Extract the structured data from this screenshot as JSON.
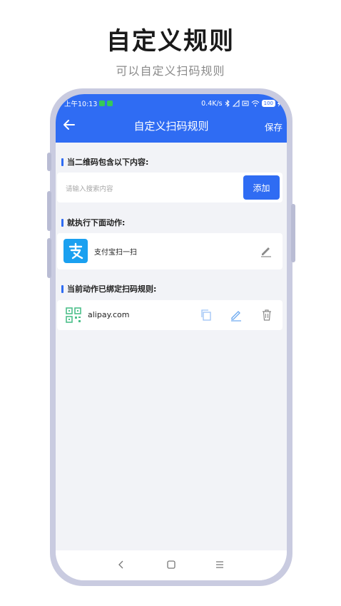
{
  "promo": {
    "title": "自定义规则",
    "subtitle": "可以自定义扫码规则"
  },
  "status_bar": {
    "time": "上午10:13",
    "speed": "0.4K/s",
    "battery": "100"
  },
  "header": {
    "title": "自定义扫码规则",
    "save_label": "保存"
  },
  "section_match": {
    "label": "当二维码包含以下内容:",
    "search_placeholder": "请输入搜索内容",
    "add_label": "添加"
  },
  "section_action": {
    "label": "就执行下面动作:",
    "action_name": "支付宝扫一扫"
  },
  "section_rules": {
    "label": "当前动作已绑定扫码规则:",
    "rules": [
      {
        "text": "alipay.com"
      }
    ]
  },
  "colors": {
    "primary": "#2f6cf3",
    "alipay": "#1aa0f0",
    "background": "#f2f3f7"
  },
  "icons": [
    "back-arrow-icon",
    "edit-icon",
    "qr-code-icon",
    "copy-icon",
    "trash-icon",
    "alipay-icon",
    "nav-back-icon",
    "nav-home-icon",
    "nav-menu-icon"
  ]
}
